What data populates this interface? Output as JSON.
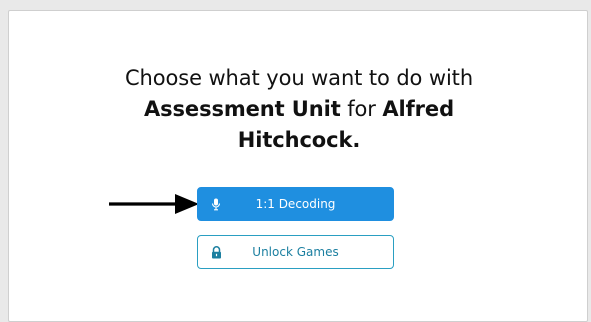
{
  "prompt": {
    "line1": "Choose what you want to do with",
    "unit_name": "Assessment Unit",
    "connector": " for ",
    "first_name": "Alfred",
    "last_name": "Hitchcock."
  },
  "buttons": {
    "decoding": {
      "label": "1:1 Decoding",
      "icon": "microphone-icon"
    },
    "unlock_games": {
      "label": "Unlock Games",
      "icon": "lock-icon"
    }
  },
  "colors": {
    "primary": "#1f8fe0",
    "secondary_border": "#2a9fc2",
    "secondary_text": "#1b7fa0",
    "background": "#e9e9e9"
  }
}
